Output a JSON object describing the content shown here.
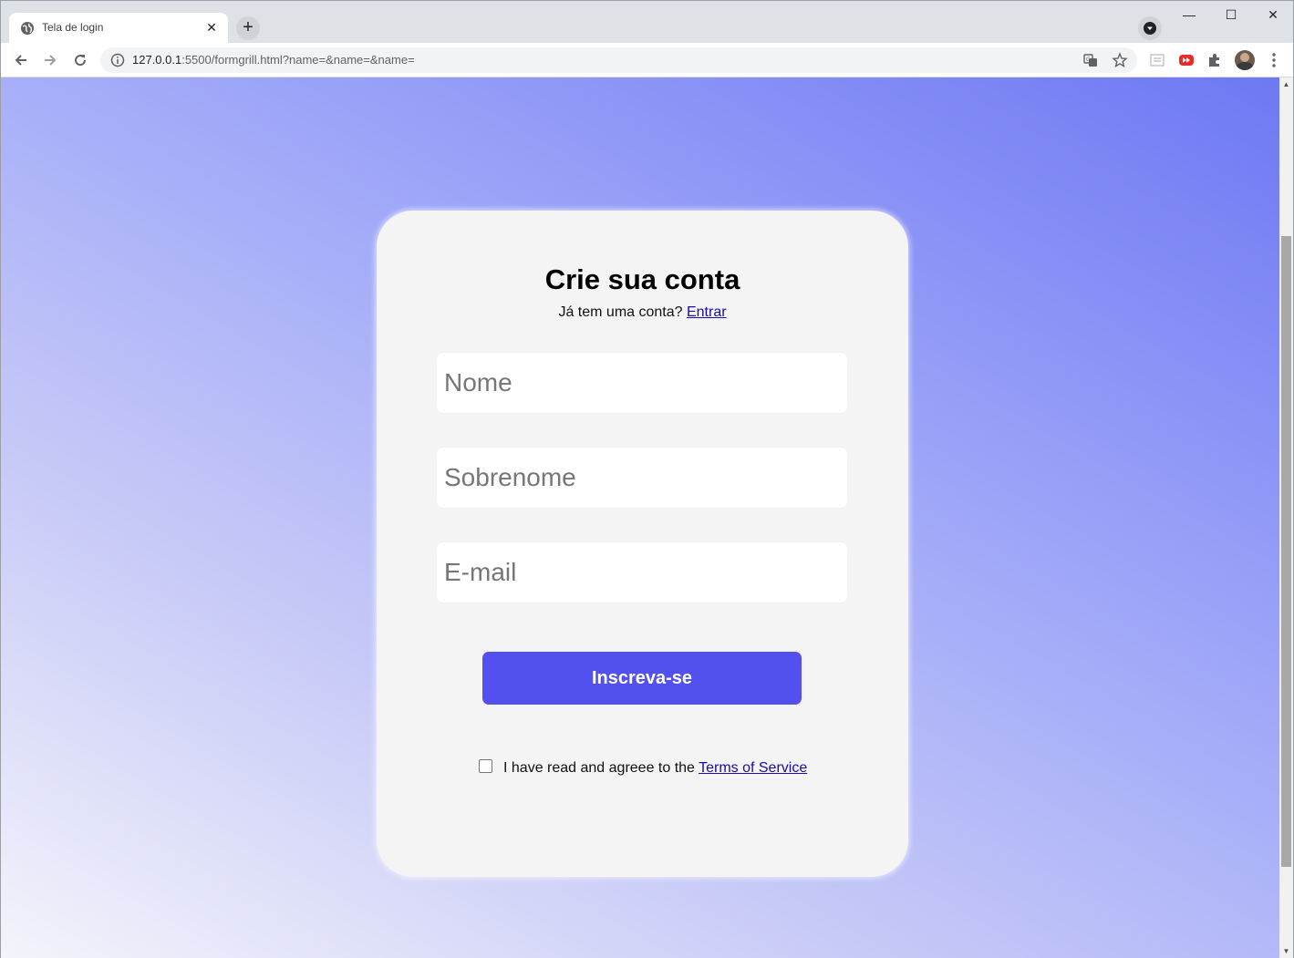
{
  "browser": {
    "tab_title": "Tela de login",
    "tab_close": "✕",
    "new_tab": "+",
    "window_controls": {
      "minimize": "—",
      "maximize": "☐",
      "close": "✕"
    },
    "url_host": "127.0.0.1",
    "url_rest": ":5500/formgrill.html?name=&name=&name="
  },
  "form": {
    "title": "Crie sua conta",
    "subtitle_text": "Já tem uma conta? ",
    "login_link": "Entrar",
    "fields": {
      "first_name_placeholder": "Nome",
      "last_name_placeholder": "Sobrenome",
      "email_placeholder": "E-mail"
    },
    "submit_label": "Inscreva-se",
    "terms_text": "I have read and agreee to the ",
    "terms_link": "Terms of Service"
  },
  "colors": {
    "accent": "#5251f0",
    "card_bg": "#f4f4f4",
    "gradient_start": "#f4f4fb",
    "gradient_end": "#6e78f3",
    "link": "#1a0dab"
  }
}
